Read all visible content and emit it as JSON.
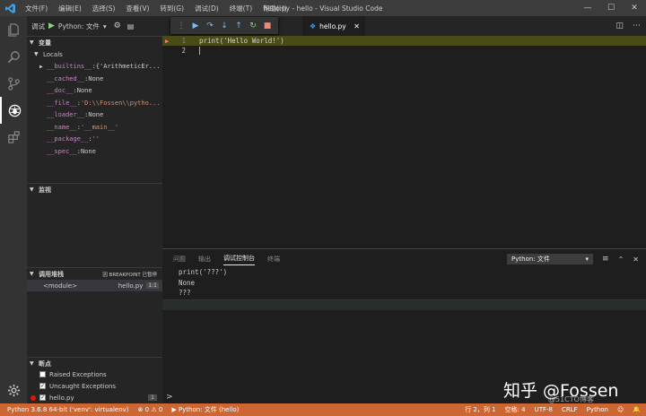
{
  "titlebar": {
    "title": "hello.py - hello - Visual Studio Code",
    "menu": [
      "文件(F)",
      "编辑(E)",
      "选择(S)",
      "查看(V)",
      "转到(G)",
      "调试(D)",
      "终端(T)",
      "帮助(H)"
    ]
  },
  "sidebar": {
    "debug_label": "调试",
    "config": "Python: 文件",
    "variables_header": "变量",
    "locals_label": "Locals",
    "variables": [
      {
        "name": "__builtins__",
        "value": "{'ArithmeticEr...",
        "expandable": true,
        "type": "obj"
      },
      {
        "name": "__cached__",
        "value": "None",
        "type": "none"
      },
      {
        "name": "__doc__",
        "value": "None",
        "type": "none"
      },
      {
        "name": "__file__",
        "value": "'D:\\\\Fossen\\\\pytho...",
        "type": "str"
      },
      {
        "name": "__loader__",
        "value": "None",
        "type": "none"
      },
      {
        "name": "__name__",
        "value": "'__main__'",
        "type": "str"
      },
      {
        "name": "__package__",
        "value": "''",
        "type": "str"
      },
      {
        "name": "__spec__",
        "value": "None",
        "type": "none"
      }
    ],
    "watch_header": "监视",
    "callstack_header": "调用堆栈",
    "callstack_status": "因 BREAKPOINT 已暂停",
    "callstack": [
      {
        "frame": "<module>",
        "file": "hello.py",
        "line": "1:1"
      }
    ],
    "breakpoints_header": "断点",
    "breakpoints": [
      {
        "label": "Raised Exceptions",
        "checked": false
      },
      {
        "label": "Uncaught Exceptions",
        "checked": true
      },
      {
        "label": "hello.py",
        "checked": true,
        "line": "1"
      }
    ]
  },
  "editor": {
    "tab_label": "hello.py",
    "lines": [
      {
        "num": "1",
        "code": "print('Hello World!')"
      },
      {
        "num": "2",
        "code": ""
      }
    ]
  },
  "panel": {
    "tabs": [
      "问题",
      "输出",
      "调试控制台",
      "终端"
    ],
    "active_tab": "调试控制台",
    "config": "Python: 文件",
    "console": [
      "print('???')",
      "None",
      "???"
    ],
    "prompt": ">"
  },
  "statusbar": {
    "interpreter": "Python 3.6.8 64-bit ('venv': virtualenv)",
    "errors": "0",
    "warnings": "0",
    "debug_config": "Python: 文件 (hello)",
    "position": "行 2，列 1",
    "spaces": "空格: 4",
    "encoding": "UTF-8",
    "eol": "CRLF",
    "language": "Python"
  },
  "watermark": {
    "text": "知乎 @Fossen",
    "sub": "@51CTO博客"
  },
  "colors": {
    "statusbar": "#cc6633",
    "accent": "#3e9ee6",
    "current_line": "#4b4b18"
  }
}
